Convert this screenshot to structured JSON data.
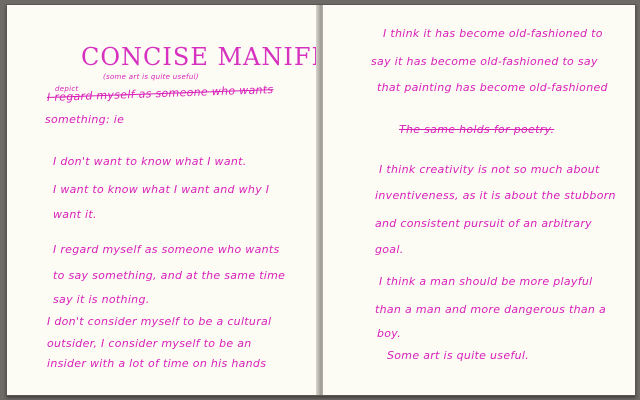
{
  "colors": {
    "ink": "#d81fb8",
    "paper": "#fcfbf4"
  },
  "left_page": {
    "title": "CONCISE MANIFESTO",
    "subtitle": "(some art is quite useful)",
    "edit_insert": "depict",
    "edit_line": "I regard myself as someone who wants",
    "edit_line2": "something: ie",
    "p1_line1": "I don't want to know what I want.",
    "p1_line2": "I want to know what I want and why I",
    "p1_line3": "want it.",
    "p2_line1": "I regard myself as someone who wants",
    "p2_line2": "to say something, and at the same time",
    "p2_line3": "say it is nothing.",
    "p3_line1": "I don't consider myself to be a cultural",
    "p3_line2": "outsider, I consider myself to be an",
    "p3_line3": "insider with a lot of time on his hands"
  },
  "right_page": {
    "l1": "I think it has become old-fashioned to",
    "l2": "say it has become old-fashioned to say",
    "l3": "that painting has become old-fashioned",
    "struck": "The same holds for poetry.",
    "p1_l1": "I think creativity is not so much about",
    "p1_l2": "inventiveness, as it is about the stubborn",
    "p1_l3": "and consistent pursuit of an arbitrary",
    "p1_l4": "goal.",
    "p2_l1": "I think a man should be more playful",
    "p2_l2": "than a man and more dangerous than a",
    "p2_l3": "boy.",
    "p3_l1": "Some art is quite useful."
  }
}
